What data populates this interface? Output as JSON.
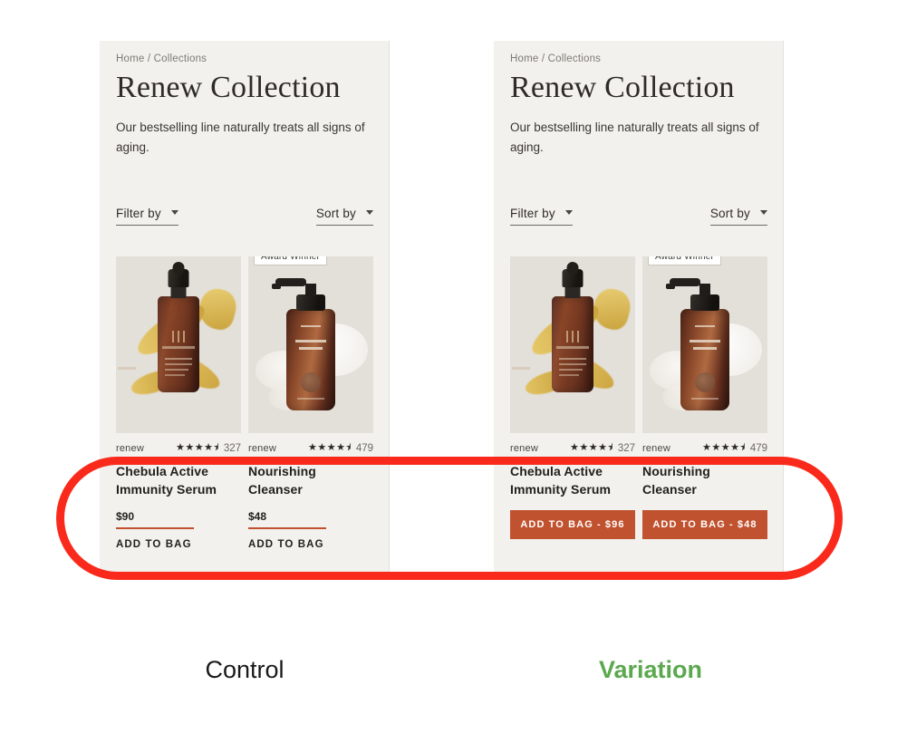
{
  "colors": {
    "panel_bg": "#f2f1ed",
    "media_bg": "#e3e0da",
    "accent_orange": "#c0522f",
    "price_rule": "#c2502f",
    "annotation_red": "#f92a1c",
    "variation_green": "#5ba84e",
    "text_dark": "#211f1c"
  },
  "annotation": {
    "ring_name": "highlight-ring"
  },
  "captions": {
    "control": "Control",
    "variation": "Variation"
  },
  "page": {
    "breadcrumb": "Home / Collections",
    "title": "Renew Collection",
    "description": "Our bestselling line naturally treats all signs of aging.",
    "filter_label": "Filter by",
    "sort_label": "Sort by",
    "badge": "Award Winner"
  },
  "variants": [
    {
      "key": "control",
      "caption": "Control",
      "cta_style": "text-link",
      "products": [
        {
          "brand": "renew",
          "stars": "★★★★⯨",
          "rating": 4.5,
          "reviews": "327",
          "name": "Chebula Active Immunity Serum",
          "price": "$90",
          "cta": "ADD TO BAG",
          "badge": null,
          "image": "serum-dropper-bottle"
        },
        {
          "brand": "renew",
          "stars": "★★★★⯨",
          "rating": 4.5,
          "reviews": "479",
          "name": "Nourishing Cleanser",
          "price": "$48",
          "cta": "ADD TO BAG",
          "badge": "Award Winner",
          "image": "cleanser-pump-bottle",
          "label_line1": "CLEAR",
          "label_line2": "NOURISHING CLEANSER"
        }
      ]
    },
    {
      "key": "variation",
      "caption": "Variation",
      "cta_style": "filled-button",
      "products": [
        {
          "brand": "renew",
          "stars": "★★★★⯨",
          "rating": 4.5,
          "reviews": "327",
          "name": "Chebula Active Immunity Serum",
          "price": "$96",
          "cta": "ADD TO BAG - $96",
          "badge": null,
          "image": "serum-dropper-bottle"
        },
        {
          "brand": "renew",
          "stars": "★★★★⯨",
          "rating": 4.5,
          "reviews": "479",
          "name": "Nourishing Cleanser",
          "price": "$48",
          "cta": "ADD TO BAG - $48",
          "badge": "Award Winner",
          "image": "cleanser-pump-bottle",
          "label_line1": "CLEAR",
          "label_line2": "NOURISHING CLEANSER"
        }
      ]
    }
  ]
}
